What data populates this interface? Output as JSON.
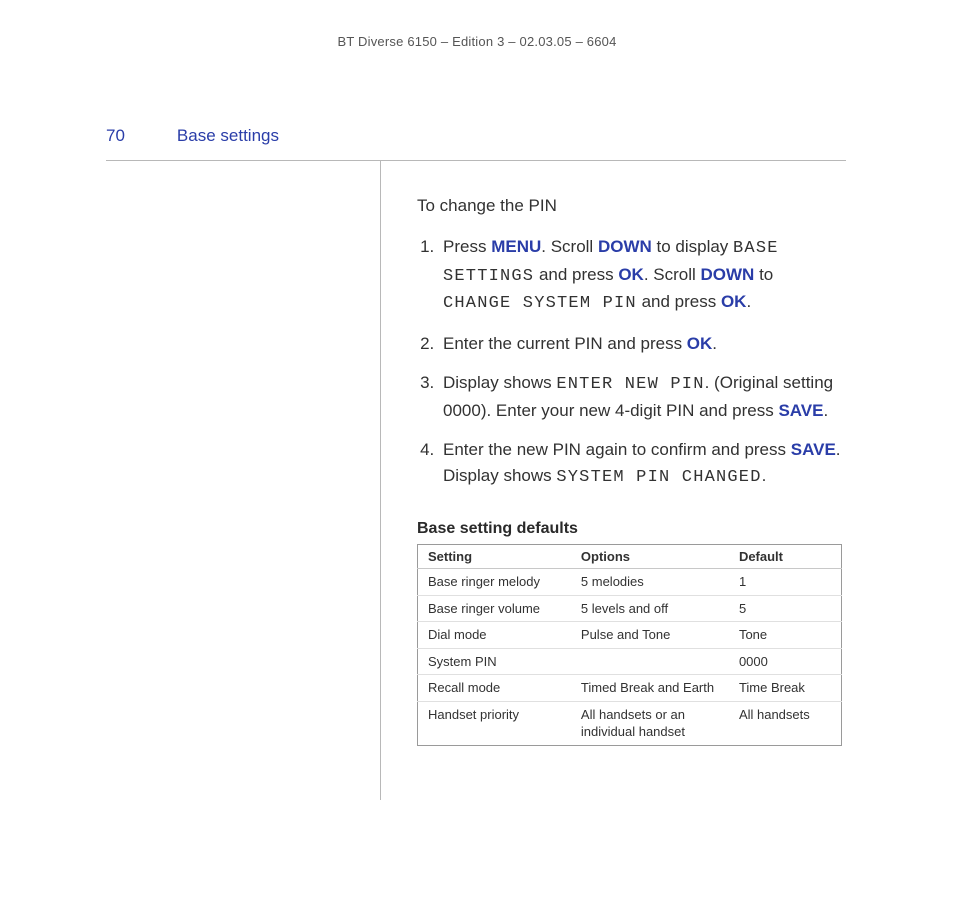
{
  "header": {
    "running": "BT Diverse 6150 – Edition 3 – 02.03.05 – 6604",
    "page_number": "70",
    "section_title": "Base settings"
  },
  "content": {
    "intro": "To change the PIN",
    "steps": {
      "s1": {
        "t0": "Press ",
        "menu": "MENU",
        "t1": ". Scroll ",
        "down": "DOWN",
        "t2": " to display ",
        "lcd1": "BASE SETTINGS",
        "t3": " and press ",
        "ok": "OK",
        "t4": ". Scroll ",
        "down2": "DOWN",
        "t5": " to ",
        "lcd2": "CHANGE SYSTEM PIN",
        "t6": " and press ",
        "ok2": "OK",
        "t7": "."
      },
      "s2": {
        "t0": "Enter the current PIN and press ",
        "ok": "OK",
        "t1": "."
      },
      "s3": {
        "t0": "Display shows ",
        "lcd": "ENTER NEW PIN",
        "t1": ". (Original setting 0000). Enter your new 4-digit PIN and press ",
        "save": "SAVE",
        "t2": "."
      },
      "s4": {
        "t0": "Enter the new PIN again to confirm and press ",
        "save": "SAVE",
        "t1": ". Display shows ",
        "lcd": "SYSTEM PIN CHANGED",
        "t2": "."
      }
    },
    "defaults_heading": "Base setting defaults",
    "table": {
      "headers": {
        "c0": "Setting",
        "c1": "Options",
        "c2": "Default"
      },
      "rows": [
        {
          "c0": "Base ringer melody",
          "c1": "5 melodies",
          "c2": "1"
        },
        {
          "c0": "Base ringer volume",
          "c1": "5 levels and off",
          "c2": "5"
        },
        {
          "c0": "Dial mode",
          "c1": "Pulse and Tone",
          "c2": "Tone"
        },
        {
          "c0": "System PIN",
          "c1": "",
          "c2": "0000"
        },
        {
          "c0": "Recall mode",
          "c1": "Timed Break and Earth",
          "c2": "Time Break"
        },
        {
          "c0": "Handset priority",
          "c1": "All handsets or an individual handset",
          "c2": "All handsets"
        }
      ]
    }
  }
}
